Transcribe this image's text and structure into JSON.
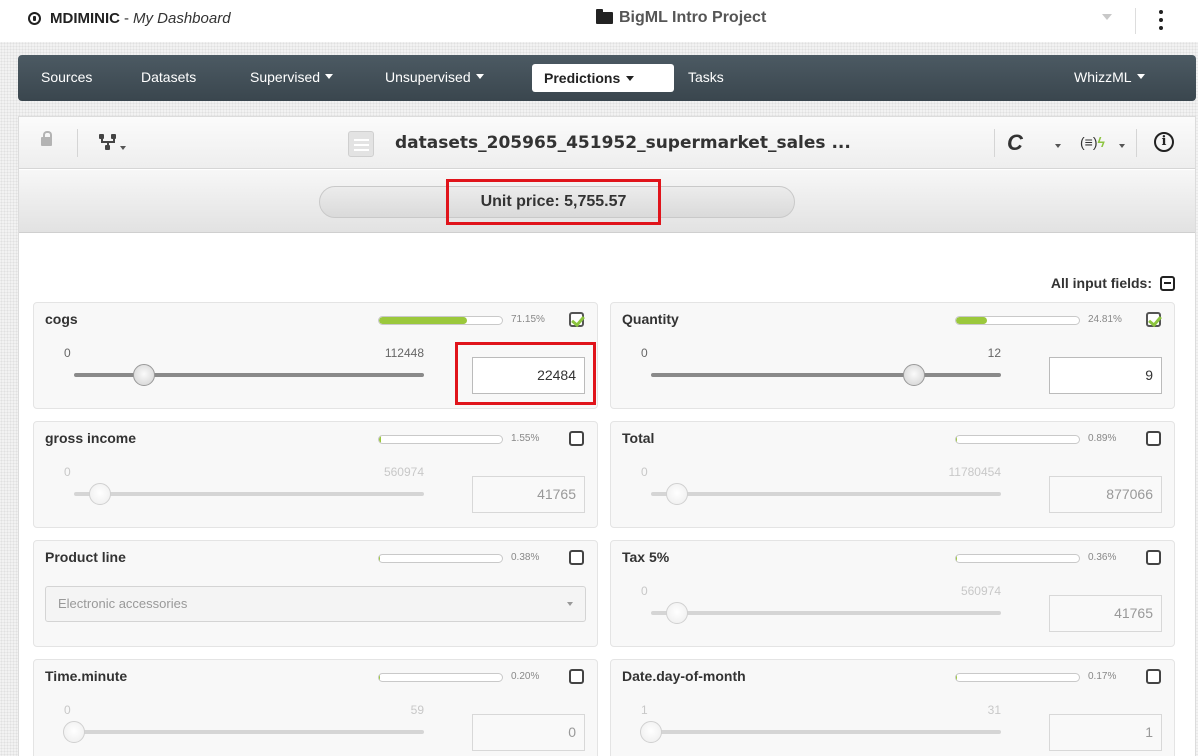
{
  "header": {
    "username": "MDIMINIC",
    "separator": "-",
    "dashboard": "My Dashboard",
    "project": "BigML Intro Project"
  },
  "nav": {
    "sources": "Sources",
    "datasets": "Datasets",
    "supervised": "Supervised",
    "unsupervised": "Unsupervised",
    "predictions": "Predictions",
    "tasks": "Tasks",
    "whizzml": "WhizzML"
  },
  "toolbar": {
    "dataset_title": "datasets_205965_451952_supermarket_sales ...",
    "formula_label": "(≡)",
    "info_label": "i"
  },
  "prediction": {
    "text": "Unit price: 5,755.57"
  },
  "all_input_fields": "All input fields:",
  "fields": [
    {
      "name": "cogs",
      "importance_pct": "71.15%",
      "importance": 0.7115,
      "checked": true,
      "min": "0",
      "max": "112448",
      "value": "22484",
      "slider_fraction": 0.2
    },
    {
      "name": "Quantity",
      "importance_pct": "24.81%",
      "importance": 0.2481,
      "checked": true,
      "min": "0",
      "max": "12",
      "value": "9",
      "slider_fraction": 0.75
    },
    {
      "name": "gross income",
      "importance_pct": "1.55%",
      "importance": 0.0155,
      "checked": false,
      "min": "0",
      "max": "560974",
      "value": "41765",
      "slider_fraction": 0.074
    },
    {
      "name": "Total",
      "importance_pct": "0.89%",
      "importance": 0.0089,
      "checked": false,
      "min": "0",
      "max": "11780454",
      "value": "877066",
      "slider_fraction": 0.074
    },
    {
      "name": "Product line",
      "importance_pct": "0.38%",
      "importance": 0.0038,
      "checked": false,
      "type": "select",
      "value": "Electronic accessories"
    },
    {
      "name": "Tax 5%",
      "importance_pct": "0.36%",
      "importance": 0.0036,
      "checked": false,
      "min": "0",
      "max": "560974",
      "value": "41765",
      "slider_fraction": 0.074
    },
    {
      "name": "Time.minute",
      "importance_pct": "0.20%",
      "importance": 0.002,
      "checked": false,
      "min": "0",
      "max": "59",
      "value": "0",
      "slider_fraction": 0
    },
    {
      "name": "Date.day-of-month",
      "importance_pct": "0.17%",
      "importance": 0.0017,
      "checked": false,
      "min": "1",
      "max": "31",
      "value": "1",
      "slider_fraction": 0
    }
  ],
  "colors": {
    "navbar": "#3f4c54",
    "importance_fill": "#9bc83c",
    "highlight": "#e0141b"
  }
}
